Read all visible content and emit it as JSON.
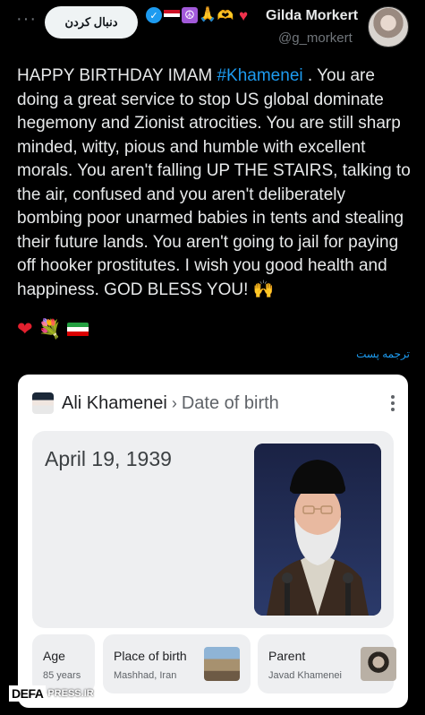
{
  "header": {
    "more_label": "···",
    "follow_label": "دنبال کردن",
    "display_name": "Gilda Morkert",
    "handle": "@g_morkert",
    "name_badges": [
      "verified-icon",
      "egypt-flag-icon",
      "peace-icon",
      "praying-hands-icon",
      "heart-hands-icon",
      "red-heart-icon"
    ]
  },
  "tweet": {
    "text_before_hashtag": "HAPPY BIRTHDAY IMAM ",
    "hashtag": "#Khamenei",
    "text_after_hashtag": " . You are doing a great service to stop US global dominate hegemony and Zionist atrocities. You are still sharp minded, witty, pious and humble with excellent morals. You aren't falling UP THE STAIRS, talking to the air, confused and you aren't deliberately bombing poor unarmed babies in tents and stealing their future lands. You aren't going to jail for paying off hooker prostitutes. I wish you good health and happiness.  GOD BLESS YOU! ",
    "trailing_emoji": "🙌",
    "emoji_row": [
      "red-heart-icon",
      "bouquet-icon",
      "iran-flag-icon"
    ],
    "translate_label": "ترجمه پست"
  },
  "card": {
    "entity": "Ali Khamenei",
    "separator": "›",
    "property": "Date of birth",
    "value": "April 19, 1939",
    "tiles": [
      {
        "label": "Age",
        "value": "85 years"
      },
      {
        "label": "Place of birth",
        "value": "Mashhad, Iran"
      },
      {
        "label": "Parent",
        "value": "Javad Khamenei"
      }
    ]
  },
  "watermark": {
    "brand": "DEFA",
    "suffix": "PRESS.IR"
  },
  "colors": {
    "background": "#000000",
    "text": "#e7e9ea",
    "muted": "#71767b",
    "link": "#1d9bf0",
    "card_bg": "#ffffff",
    "tile_bg": "#eeeff1"
  }
}
